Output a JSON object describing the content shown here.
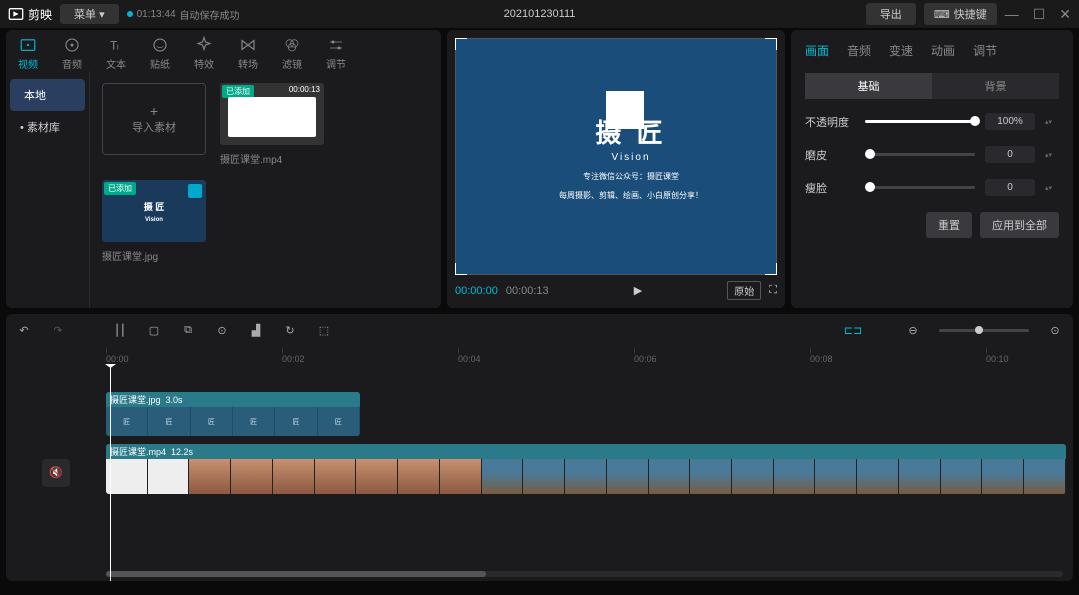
{
  "top": {
    "app": "剪映",
    "menu": "菜单",
    "time": "01:13:44",
    "autosave": "自动保存成功",
    "project": "202101230111",
    "export": "导出",
    "shortcut": "快捷键"
  },
  "tools": [
    {
      "name": "video",
      "label": "视频",
      "active": true
    },
    {
      "name": "audio",
      "label": "音频"
    },
    {
      "name": "text",
      "label": "文本"
    },
    {
      "name": "sticker",
      "label": "贴纸"
    },
    {
      "name": "effect",
      "label": "特效"
    },
    {
      "name": "transition",
      "label": "转场"
    },
    {
      "name": "filter",
      "label": "滤镜"
    },
    {
      "name": "adjust",
      "label": "调节"
    }
  ],
  "side": [
    {
      "label": "本地",
      "active": true
    },
    {
      "label": "素材库"
    }
  ],
  "import": "导入素材",
  "media": [
    {
      "badge": "已添加",
      "dur": "00:00:13",
      "name": "摄匠课堂.mp4",
      "type": "video"
    },
    {
      "badge": "已添加",
      "name": "摄匠课堂.jpg",
      "type": "image"
    }
  ],
  "preview": {
    "title": "摄 匠",
    "sub": "Vision",
    "line1": "专注微信公众号：摄匠课堂",
    "line2": "每周摄影、剪辑、绘画、小白原创分享！",
    "cur": "00:00:00",
    "dur": "00:00:13",
    "orig": "原始"
  },
  "props": {
    "tabs": [
      "画面",
      "音频",
      "变速",
      "动画",
      "调节"
    ],
    "subtabs": [
      "基础",
      "背景"
    ],
    "opacity": {
      "label": "不透明度",
      "value": "100%",
      "pct": 100
    },
    "skin": {
      "label": "磨皮",
      "value": "0",
      "pct": 0
    },
    "face": {
      "label": "瘦脸",
      "value": "0",
      "pct": 0
    },
    "reset": "重置",
    "applyAll": "应用到全部"
  },
  "ruler": [
    "00:00",
    "00:02",
    "00:04",
    "00:06",
    "00:08",
    "00:10"
  ],
  "clips": [
    {
      "name": "摄匠课堂.jpg",
      "dur": "3.0s"
    },
    {
      "name": "摄匠课堂.mp4",
      "dur": "12.2s"
    }
  ]
}
